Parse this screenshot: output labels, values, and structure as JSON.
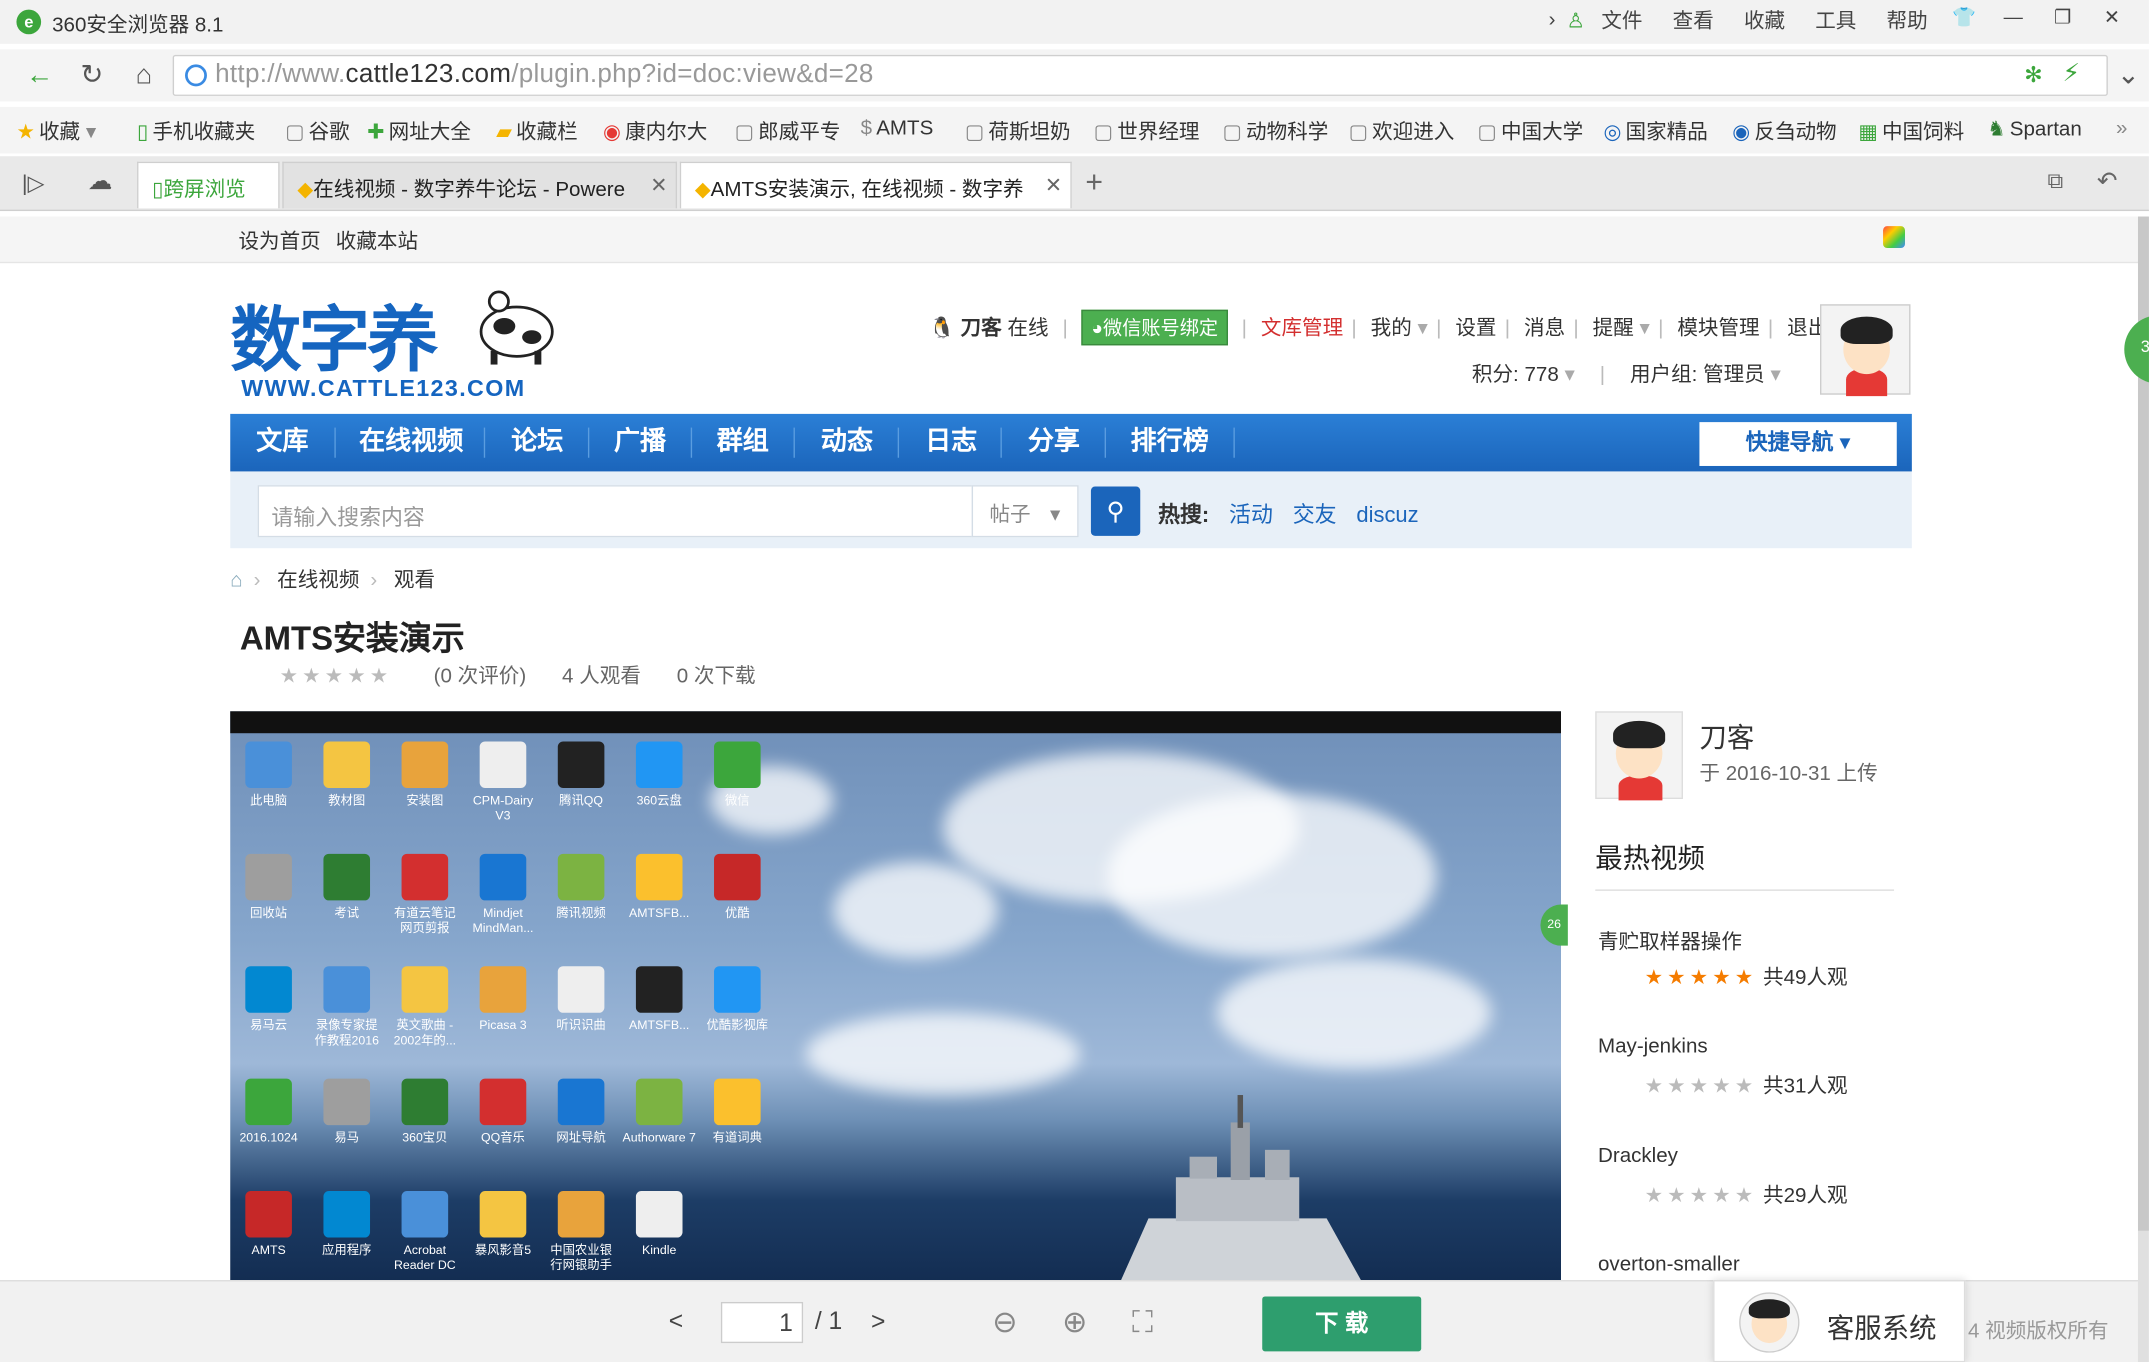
{
  "browser": {
    "title": "360安全浏览器 8.1",
    "menu": [
      "文件",
      "查看",
      "收藏",
      "工具",
      "帮助"
    ],
    "url_prefix": "http://www.",
    "url_domain": "cattle123.com",
    "url_rest": "/plugin.php?id=doc:view&d=28",
    "bookmarks": [
      "收藏",
      "手机收藏夹",
      "谷歌",
      "网址大全",
      "收藏栏",
      "康内尔大",
      "郎威平专",
      "AMTS",
      "荷斯坦奶",
      "世界经理",
      "动物科学",
      "欢迎进入",
      "中国大学",
      "国家精品",
      "反刍动物",
      "中国饲料",
      "Spartan"
    ],
    "tabs": [
      {
        "label": "跨屏浏览"
      },
      {
        "label": "在线视频 - 数字养牛论坛 - Powere"
      },
      {
        "label": "AMTS安装演示, 在线视频 - 数字养"
      }
    ]
  },
  "site": {
    "set_home": "设为首页",
    "bookmark_site": "收藏本站",
    "logo_text_a": "数字养",
    "logo_domain": "WWW.CATTLE123.COM",
    "user": {
      "name": "刀客",
      "status": "在线",
      "wechat": "微信账号绑定",
      "links": [
        "文库管理",
        "我的",
        "设置",
        "消息",
        "提醒",
        "模块管理",
        "退出"
      ],
      "points": "积分: 778",
      "group": "用户组: 管理员"
    },
    "nav": [
      "文库",
      "在线视频",
      "论坛",
      "广播",
      "群组",
      "动态",
      "日志",
      "分享",
      "排行榜"
    ],
    "quick_nav": "快捷导航",
    "search": {
      "placeholder": "请输入搜索内容",
      "type": "帖子",
      "hot_label": "热搜:",
      "hot": [
        "活动",
        "交友",
        "discuz"
      ]
    },
    "breadcrumb": [
      "在线视频",
      "观看"
    ]
  },
  "video": {
    "title": "AMTS安装演示",
    "rating_count": "(0 次评价)",
    "views": "4 人观看",
    "downloads": "0 次下载",
    "desktop_icons": [
      [
        "此电脑",
        "教材图",
        "安装图",
        "CPM-Dairy V3",
        "腾讯QQ",
        "360云盘",
        "微信"
      ],
      [
        "回收站",
        "考试",
        "有道云笔记 网页剪报",
        "Mindjet MindMan...",
        "腾讯视频",
        "AMTSFB...",
        "优酷"
      ],
      [
        "易马云",
        "录像专家提 作教程2016",
        "英文歌曲 - 2002年的...",
        "Picasa 3",
        "听识识曲",
        "AMTSFB...",
        "优酷影视库"
      ],
      [
        "2016.1024",
        "易马",
        "360宝贝",
        "QQ音乐",
        "网址导航",
        "Authorware 7",
        "有道词典"
      ],
      [
        "AMTS",
        "应用程序",
        "Acrobat Reader DC",
        "暴风影音5",
        "中国农业银 行网银助手",
        "Kindle"
      ]
    ]
  },
  "sidebar": {
    "uploader": "刀客",
    "upload_date": "于 2016-10-31 上传",
    "hot_title": "最热视频",
    "hot_videos": [
      {
        "title": "青贮取样器操作",
        "views": "共49人观"
      },
      {
        "title": "May-jenkins",
        "views": "共31人观"
      },
      {
        "title": "Drackley",
        "views": "共29人观"
      },
      {
        "title": "overton-smaller",
        "views": ""
      }
    ]
  },
  "toolbar": {
    "page": "1",
    "total": "/ 1",
    "download": "下 载",
    "service": "客服系统",
    "copyright": "4 视频版权所有"
  },
  "colors": {
    "nav": "#1b65bb",
    "download": "#2e9e6e",
    "accent_star": "#f57c00"
  }
}
